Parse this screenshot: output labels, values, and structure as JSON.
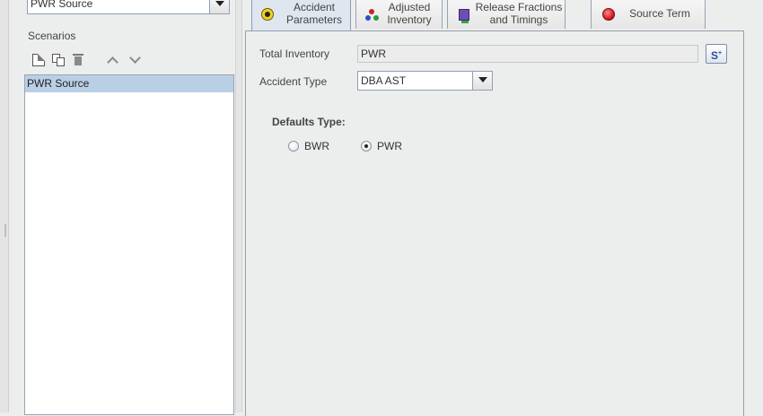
{
  "source_combo": {
    "value": "PWR Source"
  },
  "scenarios": {
    "label": "Scenarios",
    "toolbar": [
      "new-icon",
      "copy-icon",
      "delete-icon",
      "move-up-icon",
      "move-down-icon"
    ],
    "items": [
      {
        "label": "PWR Source",
        "selected": true
      }
    ]
  },
  "tabs": [
    {
      "line1": "Accident",
      "line2": "Parameters",
      "icon": "radiation-icon",
      "selected": true
    },
    {
      "line1": "Adjusted",
      "line2": "Inventory",
      "icon": "network-icon",
      "selected": false
    },
    {
      "line1": "Release Fractions",
      "line2": "and Timings",
      "icon": "monitor-icon",
      "selected": false
    },
    {
      "line1": "Source Term",
      "line2": "",
      "icon": "red-circle-icon",
      "selected": false
    }
  ],
  "form": {
    "total_inventory_label": "Total Inventory",
    "total_inventory_value": "PWR",
    "s_button_label": "S",
    "s_button_sup": "+",
    "accident_type_label": "Accident Type",
    "accident_type_value": "DBA AST",
    "defaults_type_label": "Defaults Type:",
    "radios": [
      {
        "label": "BWR",
        "checked": false
      },
      {
        "label": "PWR",
        "checked": true
      }
    ]
  },
  "colors": {
    "selection": "#b9cfe6",
    "selected_tab": "#dfe6f0",
    "panel_bg": "#eceded",
    "link_blue": "#2b4ea0"
  }
}
